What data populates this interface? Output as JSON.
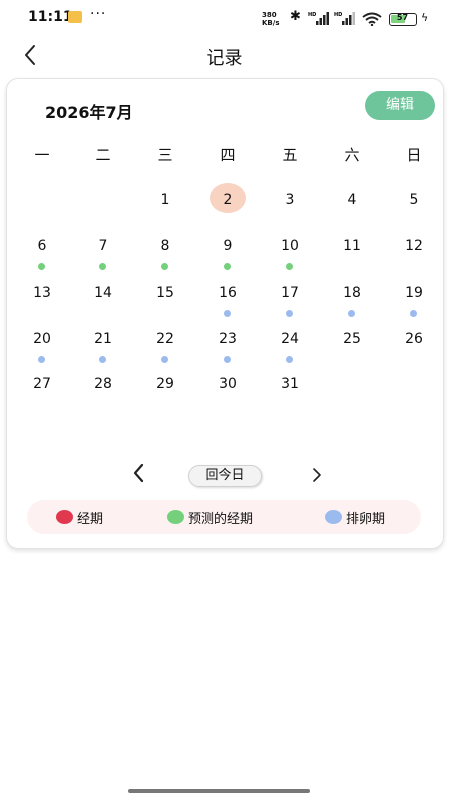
{
  "status_bar": {
    "time": "11:11",
    "dots": "···",
    "net_speed_value": "380",
    "net_speed_unit": "KB/s",
    "bluetooth": "✱",
    "battery": "57",
    "charging_bolt": "ϟ",
    "icons": [
      "photo-app-icon",
      "bluetooth-icon",
      "hd-signal-icon",
      "hd-signal-icon",
      "wifi-icon",
      "battery-icon",
      "charging-icon"
    ]
  },
  "header": {
    "title": "记录",
    "back_icon": "chevron-left-icon"
  },
  "calendar": {
    "month_label": "2026年7月",
    "edit_label": "编辑",
    "weekdays": [
      "一",
      "二",
      "三",
      "四",
      "五",
      "六",
      "日"
    ],
    "today": 2,
    "days": [
      {
        "day": "1",
        "col": 2,
        "row": 0,
        "marker": "none"
      },
      {
        "day": "2",
        "col": 3,
        "row": 0,
        "marker": "today"
      },
      {
        "day": "3",
        "col": 4,
        "row": 0,
        "marker": "none"
      },
      {
        "day": "4",
        "col": 5,
        "row": 0,
        "marker": "none"
      },
      {
        "day": "5",
        "col": 6,
        "row": 0,
        "marker": "none"
      },
      {
        "day": "6",
        "col": 0,
        "row": 1,
        "marker": "predicted"
      },
      {
        "day": "7",
        "col": 1,
        "row": 1,
        "marker": "predicted"
      },
      {
        "day": "8",
        "col": 2,
        "row": 1,
        "marker": "predicted"
      },
      {
        "day": "9",
        "col": 3,
        "row": 1,
        "marker": "predicted"
      },
      {
        "day": "10",
        "col": 4,
        "row": 1,
        "marker": "predicted"
      },
      {
        "day": "11",
        "col": 5,
        "row": 1,
        "marker": "none"
      },
      {
        "day": "12",
        "col": 6,
        "row": 1,
        "marker": "none"
      },
      {
        "day": "13",
        "col": 0,
        "row": 2,
        "marker": "none"
      },
      {
        "day": "14",
        "col": 1,
        "row": 2,
        "marker": "none"
      },
      {
        "day": "15",
        "col": 2,
        "row": 2,
        "marker": "none"
      },
      {
        "day": "16",
        "col": 3,
        "row": 2,
        "marker": "ovulation"
      },
      {
        "day": "17",
        "col": 4,
        "row": 2,
        "marker": "ovulation"
      },
      {
        "day": "18",
        "col": 5,
        "row": 2,
        "marker": "ovulation"
      },
      {
        "day": "19",
        "col": 6,
        "row": 2,
        "marker": "ovulation"
      },
      {
        "day": "20",
        "col": 0,
        "row": 3,
        "marker": "ovulation"
      },
      {
        "day": "21",
        "col": 1,
        "row": 3,
        "marker": "ovulation"
      },
      {
        "day": "22",
        "col": 2,
        "row": 3,
        "marker": "ovulation"
      },
      {
        "day": "23",
        "col": 3,
        "row": 3,
        "marker": "ovulation"
      },
      {
        "day": "24",
        "col": 4,
        "row": 3,
        "marker": "ovulation"
      },
      {
        "day": "25",
        "col": 5,
        "row": 3,
        "marker": "none"
      },
      {
        "day": "26",
        "col": 6,
        "row": 3,
        "marker": "none"
      },
      {
        "day": "27",
        "col": 0,
        "row": 4,
        "marker": "none"
      },
      {
        "day": "28",
        "col": 1,
        "row": 4,
        "marker": "none"
      },
      {
        "day": "29",
        "col": 2,
        "row": 4,
        "marker": "none"
      },
      {
        "day": "30",
        "col": 3,
        "row": 4,
        "marker": "none"
      },
      {
        "day": "31",
        "col": 4,
        "row": 4,
        "marker": "none"
      }
    ],
    "nav": {
      "prev_icon": "chevron-left-icon",
      "today_label": "回今日",
      "next_icon": "chevron-right-icon"
    }
  },
  "legend": [
    {
      "label": "经期",
      "color": "#e0394f"
    },
    {
      "label": "预测的经期",
      "color": "#74d07b"
    },
    {
      "label": "排卵期",
      "color": "#9bbbef"
    }
  ],
  "colors": {
    "accent": "#6ec59b",
    "today_highlight": "#f8d3c2",
    "predicted": "#74d07b",
    "ovulation": "#9bbbef",
    "period": "#e0394f",
    "legend_bg": "#fdf1f1"
  }
}
